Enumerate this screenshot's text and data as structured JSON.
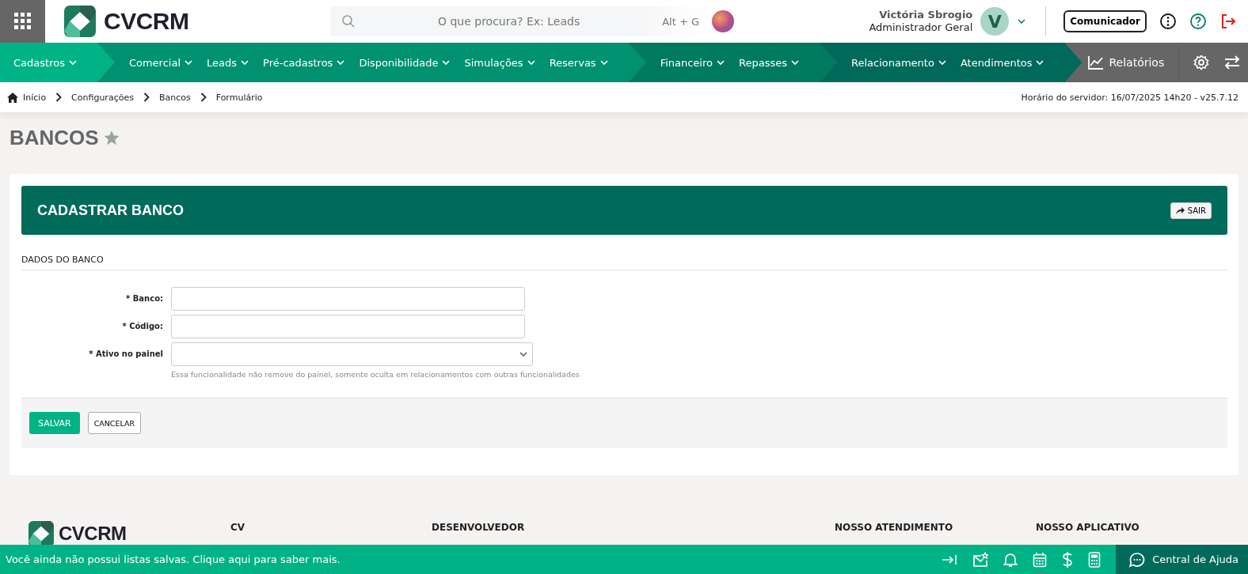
{
  "header": {
    "logo": "CVCRM",
    "search": {
      "placeholder": "O que procura? Ex: Leads",
      "shortcut": "Alt + G"
    },
    "user": {
      "name": "Victória Sbrogio",
      "role": "Administrador Geral",
      "initial": "V"
    },
    "communicator": "Comunicador"
  },
  "nav": {
    "groups": [
      {
        "color": "#00b386",
        "items": [
          "Cadastros"
        ]
      },
      {
        "color": "#009170",
        "items": [
          "Comercial",
          "Leads",
          "Pré-cadastros",
          "Disponibilidade",
          "Simulações",
          "Reservas"
        ]
      },
      {
        "color": "#007a5f",
        "items": [
          "Financeiro",
          "Repasses"
        ]
      },
      {
        "color": "#00695a",
        "items": [
          "Relacionamento",
          "Atendimentos"
        ]
      }
    ],
    "reports": "Relatórios"
  },
  "breadcrumb": [
    "Início",
    "Configurações",
    "Bancos",
    "Formulário"
  ],
  "server_time": "Horário do servidor: 16/07/2025 14h20 - v25.7.12",
  "page_title": "BANCOS",
  "form": {
    "title": "CADASTRAR BANCO",
    "exit": "SAIR",
    "section": "DADOS DO BANCO",
    "fields": [
      {
        "kind": "text",
        "label": "* Banco:"
      },
      {
        "kind": "text",
        "label": "* Código:"
      },
      {
        "kind": "select",
        "label": "* Ativo no painel",
        "hint": "Essa funcionalidade não remove do painel, somente oculta em relacionamentos com outras funcionalidades"
      }
    ],
    "save": "SALVAR",
    "cancel": "CANCELAR"
  },
  "footer": {
    "logo": "CVCRM",
    "columns": [
      "CV",
      "DESENVOLVEDOR",
      "NOSSO ATENDIMENTO",
      "NOSSO APLICATIVO"
    ]
  },
  "bottom_bar": {
    "message": "Você ainda não possui listas salvas. Clique aqui para saber mais.",
    "help": "Central de Ajuda"
  }
}
